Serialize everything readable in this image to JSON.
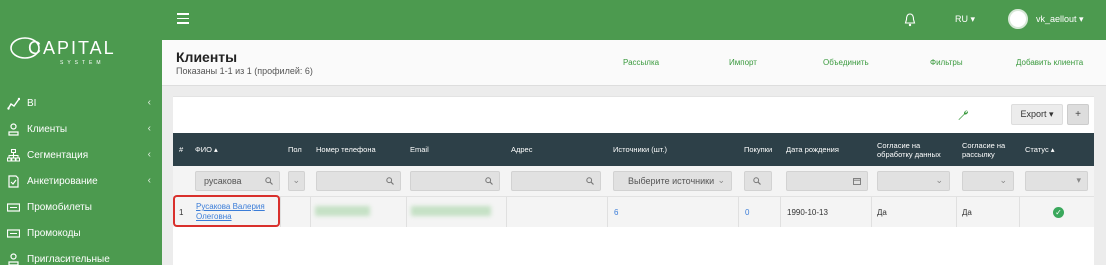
{
  "brand": {
    "logo_text": "CAPITAL",
    "logo_sub": "SYSTEM"
  },
  "topbar": {
    "lang": "RU ▾",
    "user": "vk_aellout ▾"
  },
  "sidebar": {
    "items": [
      {
        "label": "BI",
        "icon": "chart-line-icon",
        "has_chevron": true
      },
      {
        "label": "Клиенты",
        "icon": "user-icon",
        "has_chevron": true
      },
      {
        "label": "Сегментация",
        "icon": "sitemap-icon",
        "has_chevron": true
      },
      {
        "label": "Анкетирование",
        "icon": "survey-icon",
        "has_chevron": true
      },
      {
        "label": "Промобилеты",
        "icon": "ticket-icon",
        "has_chevron": false
      },
      {
        "label": "Промокоды",
        "icon": "ticket-icon",
        "has_chevron": false
      },
      {
        "label": "Пригласительные",
        "icon": "user-icon",
        "has_chevron": false
      }
    ],
    "chevron": "‹"
  },
  "header": {
    "title": "Клиенты",
    "subtitle": "Показаны 1-1 из 1 (профилей: 6)",
    "links": [
      "Рассылка",
      "Импорт",
      "Объединить",
      "Фильтры",
      "Добавить клиента"
    ]
  },
  "toolbar": {
    "export_label": "Export ▾",
    "plus_label": "+"
  },
  "table": {
    "headers": [
      "#",
      "ФИО ▴",
      "Пол",
      "Номер телефона",
      "Email",
      "Адрес",
      "Источники (шт.)",
      "Покупки",
      "Дата рождения",
      "Согласие на обработку данных",
      "Согласие на рассылку",
      "Статус ▴"
    ],
    "filters": {
      "fio": "русакова",
      "sources_placeholder": "Выберите источники"
    },
    "row": {
      "num": "1",
      "name_line1": "Русакова Валерия",
      "name_line2": "Олеговна",
      "sources": "6",
      "purchases": "0",
      "birthdate": "1990-10-13",
      "consent_data": "Да",
      "consent_mail": "Да"
    }
  },
  "colors": {
    "primary": "#4c9a4f",
    "table_header": "#2d4048",
    "link": "#3b7dd8",
    "highlight": "#d9302c"
  }
}
